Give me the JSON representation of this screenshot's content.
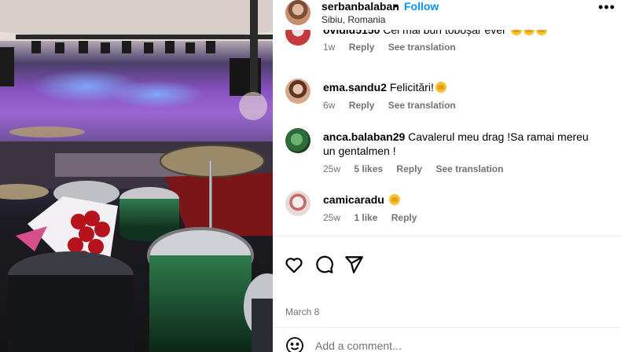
{
  "post": {
    "author": "serbanbalaban",
    "separator": "•",
    "follow_label": "Follow",
    "location": "Sibiu, Romania",
    "more_label": "•••",
    "date": "March 8"
  },
  "comments": [
    {
      "user": "ovidiu5150",
      "text": " Cel mai bun toboșar ever",
      "time": "1w",
      "likes": "",
      "reply_label": "Reply",
      "translate_label": "See translation",
      "avatar_color": "#c43a3a"
    },
    {
      "user": "ema.sandu2",
      "text": " Felicitări!",
      "time": "6w",
      "likes": "",
      "reply_label": "Reply",
      "translate_label": "See translation",
      "avatar_color": "#b06a52"
    },
    {
      "user": "anca.balaban29",
      "text": " Cavalerul meu drag !Sa ramai mereu un gentalmen !",
      "time": "25w",
      "likes": "5 likes",
      "reply_label": "Reply",
      "translate_label": "See translation",
      "avatar_color": "#2e6b3a"
    },
    {
      "user": "camicaradu",
      "text": " ",
      "time": "25w",
      "likes": "1 like",
      "reply_label": "Reply",
      "translate_label": "",
      "avatar_color": "#d9c9c4"
    }
  ],
  "actions": {
    "like_icon": "heart-icon",
    "comment_icon": "comment-bubble-icon",
    "share_icon": "paper-plane-icon"
  },
  "composer": {
    "placeholder": "Add a comment...",
    "emoji_icon": "smiley-icon"
  },
  "colors": {
    "accent": "#0095f6",
    "secondary_text": "#737373"
  }
}
